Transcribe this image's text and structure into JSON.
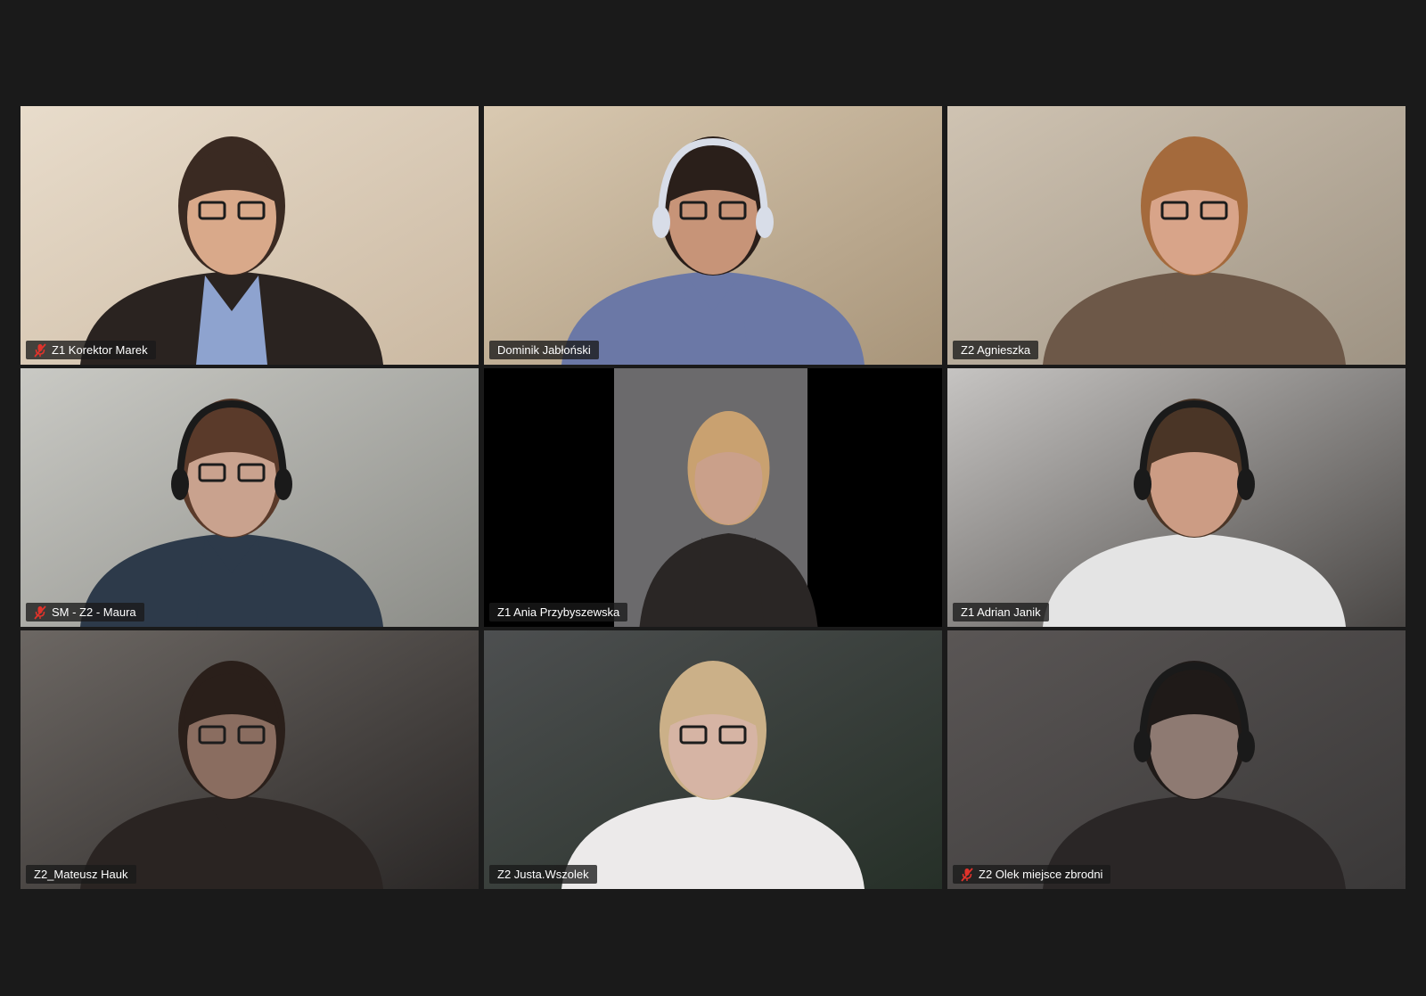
{
  "app": {
    "background": "#1a1a1a",
    "active_speaker_color": "#6fd63a",
    "muted_icon_color": "#e0332b"
  },
  "participants": [
    {
      "name": "Z1 Korektor Marek",
      "muted": true,
      "active": false,
      "bg": "#e8dccb",
      "bg2": "#cbb9a2",
      "skin": "#d9a98a",
      "hair": "#3a2a22",
      "shirt": "#8ea3cf",
      "jacket": "#2a2320",
      "headset": false,
      "glasses": true
    },
    {
      "name": "Dominik Jabłoński",
      "muted": false,
      "active": false,
      "bg": "#d9c9b1",
      "bg2": "#a8957a",
      "skin": "#c79478",
      "hair": "#2a1f1a",
      "shirt": "#6b78a6",
      "jacket": "#6b78a6",
      "headset": true,
      "glasses": true
    },
    {
      "name": "Z2 Agnieszka",
      "muted": false,
      "active": false,
      "bg": "#cfc3b2",
      "bg2": "#9e9383",
      "skin": "#d8a489",
      "hair": "#a46a3c",
      "shirt": "#6d5848",
      "jacket": "#6d5848",
      "headset": false,
      "glasses": true
    },
    {
      "name": "SM - Z2 - Maura",
      "muted": true,
      "active": false,
      "bg": "#c9c9c4",
      "bg2": "#8c8d88",
      "skin": "#c9a28e",
      "hair": "#5a3a2a",
      "shirt": "#2d3a4a",
      "jacket": "#2d3a4a",
      "headset": true,
      "glasses": true
    },
    {
      "name": "Z1 Ania Przybyszewska",
      "muted": false,
      "active": false,
      "bg": "#000000",
      "bg2": "#6b6a6c",
      "skin": "#caa08a",
      "hair": "#c9a170",
      "shirt": "#2a2625",
      "jacket": "#2a2625",
      "headset": false,
      "glasses": false
    },
    {
      "name": "Z1 Adrian Janik",
      "muted": false,
      "active": true,
      "bg": "#c6c4c2",
      "bg2": "#4a4745",
      "skin": "#cc9c84",
      "hair": "#4a3526",
      "shirt": "#e4e4e4",
      "jacket": "#e4e4e4",
      "headset": true,
      "glasses": false
    },
    {
      "name": "Z2_Mateusz Hauk",
      "muted": false,
      "active": false,
      "bg": "#6c6763",
      "bg2": "#2a2726",
      "skin": "#8a6d60",
      "hair": "#2a1f1a",
      "shirt": "#2a2422",
      "jacket": "#2a2422",
      "headset": false,
      "glasses": true
    },
    {
      "name": "Z2 Justa.Wszolek",
      "muted": false,
      "active": false,
      "bg": "#4d4f50",
      "bg2": "#263028",
      "skin": "#d6b4a4",
      "hair": "#cbb088",
      "shirt": "#eceaea",
      "jacket": "#eceaea",
      "headset": false,
      "glasses": true
    },
    {
      "name": "Z2 Olek miejsce zbrodni",
      "muted": true,
      "active": false,
      "bg": "#5a5655",
      "bg2": "#3a3838",
      "skin": "#8e7a72",
      "hair": "#1f1a18",
      "shirt": "#2a2626",
      "jacket": "#2a2626",
      "headset": true,
      "glasses": false
    }
  ]
}
